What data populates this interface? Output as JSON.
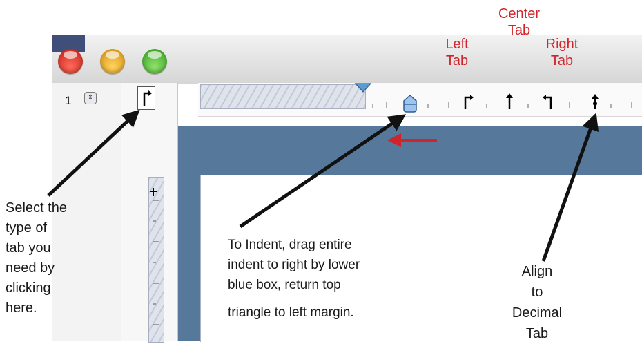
{
  "window": {
    "page_number": "1",
    "stepper_glyph": "⇕"
  },
  "ruler_labels": {
    "left_tab": "Left\nTab",
    "center_tab": "Center\nTab",
    "right_tab": "Right\nTab"
  },
  "annotations": {
    "select_tab": "Select the\ntype of\ntab you\nneed by\nclicking\nhere.",
    "indent_line1": "To Indent, drag entire",
    "indent_line2": "indent to right by lower",
    "indent_line3": "blue box, return top",
    "indent_line4": "triangle to left margin.",
    "decimal_tab": "Align\nto\nDecimal\nTab"
  },
  "colors": {
    "label_red": "#d0242b",
    "document_blue": "#56789b",
    "arrow_red": "#d0242b",
    "indent_marker": "#5b9bd5"
  },
  "icons": [
    "close-button-red",
    "minimize-button-yellow",
    "zoom-button-green",
    "left-tab-icon",
    "center-tab-icon",
    "right-tab-icon",
    "decimal-tab-icon",
    "first-line-indent-triangle",
    "left-indent-box"
  ]
}
